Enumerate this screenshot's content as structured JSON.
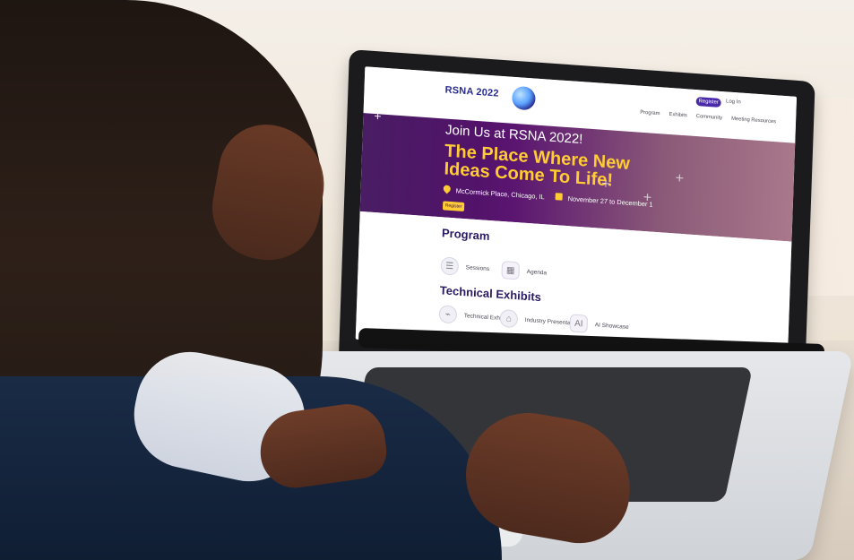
{
  "screen": {
    "brand": {
      "event": "RSNA 2022"
    },
    "header": {
      "register": "Register",
      "login": "Log In",
      "nav": [
        "Program",
        "Exhibits",
        "Community",
        "Meeting Resources"
      ]
    },
    "hero": {
      "join": "Join Us at RSNA 2022!",
      "title": "The Place Where New Ideas Come To Life!",
      "location": "McCormick Place, Chicago, IL",
      "dates": "November 27 to December 1",
      "cta": "Register"
    },
    "program": {
      "title": "Program",
      "tiles": [
        {
          "label": "Sessions",
          "icon": "sessions-icon"
        },
        {
          "label": "Agenda",
          "icon": "agenda-icon"
        }
      ]
    },
    "technical_exhibits": {
      "title": "Technical Exhibits",
      "tiles": [
        {
          "label": "Technical Exhibits",
          "icon": "technical-exhibits-icon"
        },
        {
          "label": "Industry Presentations",
          "icon": "industry-presentations-icon"
        },
        {
          "label": "AI Showcase",
          "icon": "ai-showcase-icon"
        }
      ]
    }
  }
}
